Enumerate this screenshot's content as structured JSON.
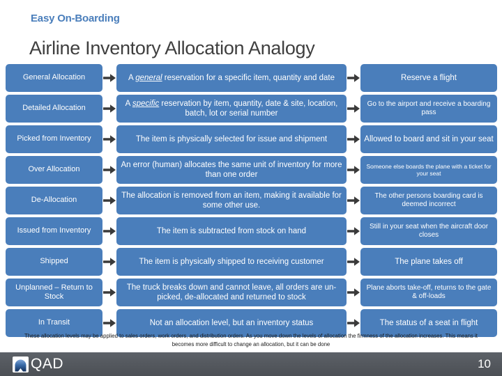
{
  "header": {
    "kicker": "Easy On-Boarding",
    "title": "Airline Inventory Allocation Analogy"
  },
  "colors": {
    "box_blue": "#4a7ebb",
    "kicker_blue": "#4a7ebb",
    "title_gray": "#3f3f3f",
    "arrow_dark": "#3a3a3a",
    "bottombar_gray": "#55595f"
  },
  "matrix": {
    "arrow_icon": "arrow-right-icon",
    "rows": [
      {
        "level": "General Allocation",
        "definition_prefix": "A ",
        "definition_emphasis": "general",
        "definition_suffix": " reservation for a specific item, quantity and date",
        "analogy": "Reserve a flight",
        "analogy_size": "normal"
      },
      {
        "level": "Detailed Allocation",
        "definition_prefix": "A ",
        "definition_emphasis": "specific",
        "definition_suffix": " reservation by item, quantity, date & site, location, batch, lot or serial number",
        "analogy": "Go to the airport and receive a boarding pass",
        "analogy_size": "md"
      },
      {
        "level": "Picked from Inventory",
        "definition_prefix": "The item is physically selected for issue and shipment",
        "definition_emphasis": "",
        "definition_suffix": "",
        "analogy": "Allowed to board and sit in your seat",
        "analogy_size": "normal"
      },
      {
        "level": "Over Allocation",
        "definition_prefix": "An error (human) allocates the same unit of inventory for more than one order",
        "definition_emphasis": "",
        "definition_suffix": "",
        "analogy": "Someone else boards the plane with a ticket for your seat",
        "analogy_size": "sm"
      },
      {
        "level": "De-Allocation",
        "definition_prefix": "The allocation is removed from an item, making  it available for some other use.",
        "definition_emphasis": "",
        "definition_suffix": "",
        "analogy": "The other persons boarding card is deemed  incorrect",
        "analogy_size": "md"
      },
      {
        "level": "Issued from Inventory",
        "definition_prefix": "The item is subtracted from stock on hand",
        "definition_emphasis": "",
        "definition_suffix": "",
        "analogy": "Still in your seat  when the aircraft door closes",
        "analogy_size": "md"
      },
      {
        "level": "Shipped",
        "definition_prefix": "The item is physically shipped to receiving customer",
        "definition_emphasis": "",
        "definition_suffix": "",
        "analogy": "The plane takes off",
        "analogy_size": "normal"
      },
      {
        "level": "Unplanned – Return to Stock",
        "definition_prefix": "The truck breaks down and cannot leave, all orders are un-picked, de-allocated and returned to stock",
        "definition_emphasis": "",
        "definition_suffix": "",
        "analogy": "Plane aborts  take-off, returns to the gate & off-loads",
        "analogy_size": "md"
      },
      {
        "level": "In Transit",
        "definition_prefix": "Not an allocation level, but an inventory status",
        "definition_emphasis": "",
        "definition_suffix": "",
        "analogy": "The status of a seat in flight",
        "analogy_size": "normal"
      }
    ]
  },
  "footnote": "These allocation levels may be applied to sales orders, work orders, and distribution orders. As you move down the levels of allocation the firmness of the allocation increases. This means it becomes more difficult to change an allocation, but it can be done",
  "footer": {
    "logo_text": "QAD",
    "logo_mark": "qad-arch-icon",
    "page_number": "10"
  }
}
